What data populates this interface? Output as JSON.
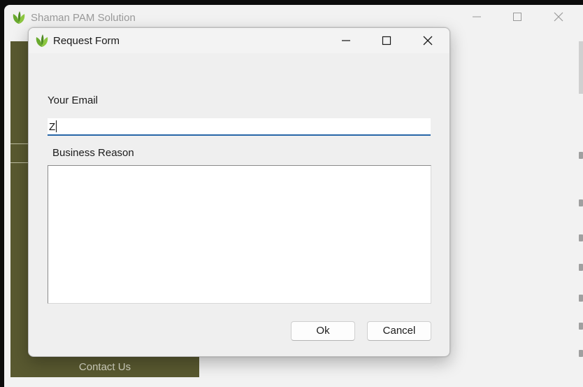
{
  "main_window": {
    "title": "Shaman PAM Solution",
    "logo_icon": "leaf-icon",
    "sidebar": {
      "contact_label": "Contact Us"
    }
  },
  "dialog": {
    "title": "Request Form",
    "logo_icon": "leaf-icon",
    "email": {
      "label": "Your Email",
      "value": "Z"
    },
    "reason": {
      "label": "Business Reason",
      "value": ""
    },
    "buttons": {
      "ok": "Ok",
      "cancel": "Cancel"
    }
  },
  "colors": {
    "sidebar": "#595930",
    "accent_underline": "#2766a8",
    "logo_green": "#5f9e2a"
  }
}
